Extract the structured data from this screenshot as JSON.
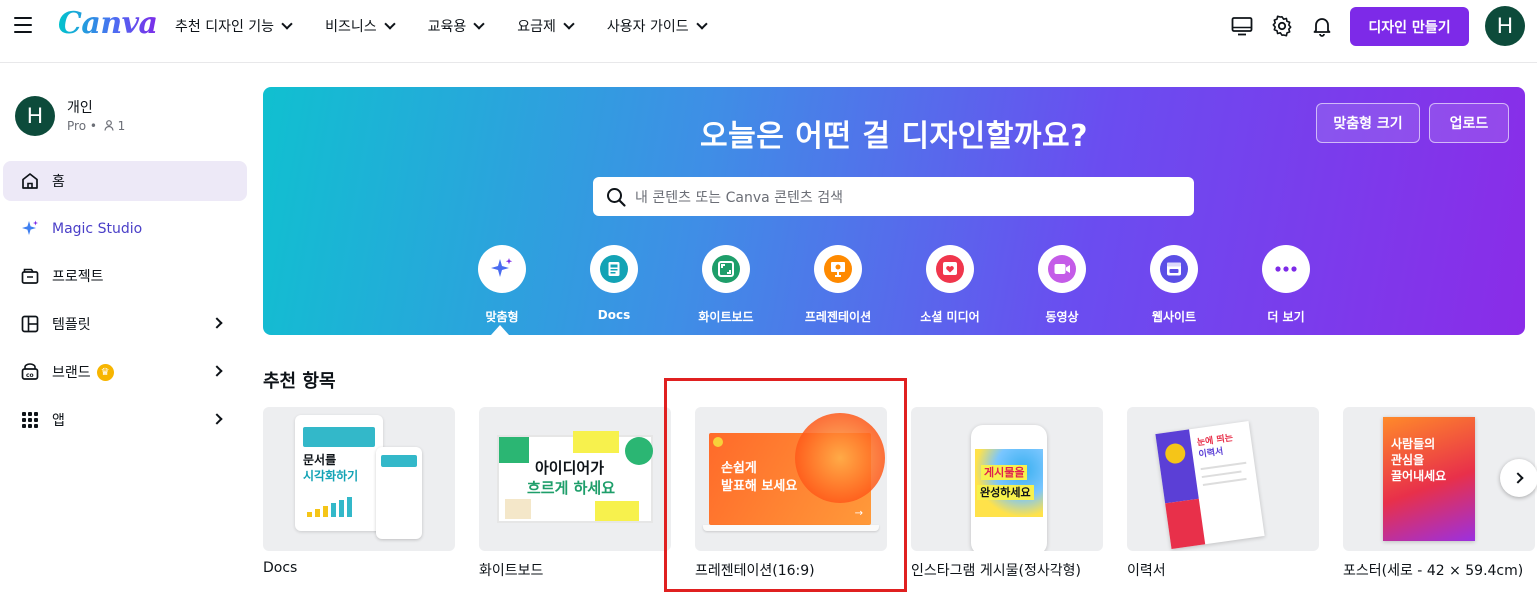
{
  "brand": {
    "logo": "Canva"
  },
  "nav": [
    {
      "label": "추천 디자인 기능"
    },
    {
      "label": "비즈니스"
    },
    {
      "label": "교육용"
    },
    {
      "label": "요금제"
    },
    {
      "label": "사용자 가이드"
    }
  ],
  "topbar": {
    "create_label": "디자인 만들기",
    "avatar_initial": "H",
    "icons": [
      "desktop-icon",
      "gear-icon",
      "bell-icon"
    ]
  },
  "account": {
    "avatar_initial": "H",
    "name": "개인",
    "plan": "Pro •",
    "members": "1"
  },
  "sidebar": {
    "items": [
      {
        "label": "홈",
        "icon": "home-icon",
        "active": true
      },
      {
        "label": "Magic Studio",
        "icon": "sparkle-icon"
      },
      {
        "label": "프로젝트",
        "icon": "folder-icon"
      },
      {
        "label": "템플릿",
        "icon": "template-icon"
      },
      {
        "label": "브랜드",
        "icon": "brand-icon"
      },
      {
        "label": "앱",
        "icon": "apps-icon"
      }
    ]
  },
  "hero": {
    "title": "오늘은 어떤 걸 디자인할까요?",
    "custom_size_label": "맞춤형 크기",
    "upload_label": "업로드",
    "search_placeholder": "내 콘텐츠 또는 Canva 콘텐츠 검색",
    "categories": [
      {
        "label": "맞춤형",
        "icon": "sparkle-icon",
        "color": "#5b4fe6"
      },
      {
        "label": "Docs",
        "icon": "docs-icon",
        "color": "#13a3b5"
      },
      {
        "label": "화이트보드",
        "icon": "whiteboard-icon",
        "color": "#1e9e6a"
      },
      {
        "label": "프레젠테이션",
        "icon": "presentation-icon",
        "color": "#ff8a00"
      },
      {
        "label": "소셜 미디어",
        "icon": "heart-icon",
        "color": "#f0364c"
      },
      {
        "label": "동영상",
        "icon": "video-icon",
        "color": "#9b4de8"
      },
      {
        "label": "웹사이트",
        "icon": "website-icon",
        "color": "#5b4fe6"
      },
      {
        "label": "더 보기",
        "icon": "more-icon",
        "color": "#7d2ae8"
      }
    ]
  },
  "recommended": {
    "title": "추천 항목",
    "cards": [
      {
        "label": "Docs",
        "thumb_lines": [
          "문서를",
          "시각화하기"
        ]
      },
      {
        "label": "화이트보드",
        "thumb_lines": [
          "아이디어가",
          "흐르게 하세요"
        ]
      },
      {
        "label": "프레젠테이션(16:9)",
        "thumb_lines": [
          "손쉽게",
          "발표해 보세요"
        ]
      },
      {
        "label": "인스타그램 게시물(정사각형)",
        "thumb_lines": [
          "게시물을",
          "완성하세요"
        ]
      },
      {
        "label": "이력서",
        "thumb_lines": [
          "눈에 띄는",
          "이력서"
        ]
      },
      {
        "label": "포스터(세로 - 42 × 59.4cm)",
        "thumb_lines": [
          "사람들의",
          "관심을",
          "끌어내세요"
        ]
      }
    ]
  }
}
